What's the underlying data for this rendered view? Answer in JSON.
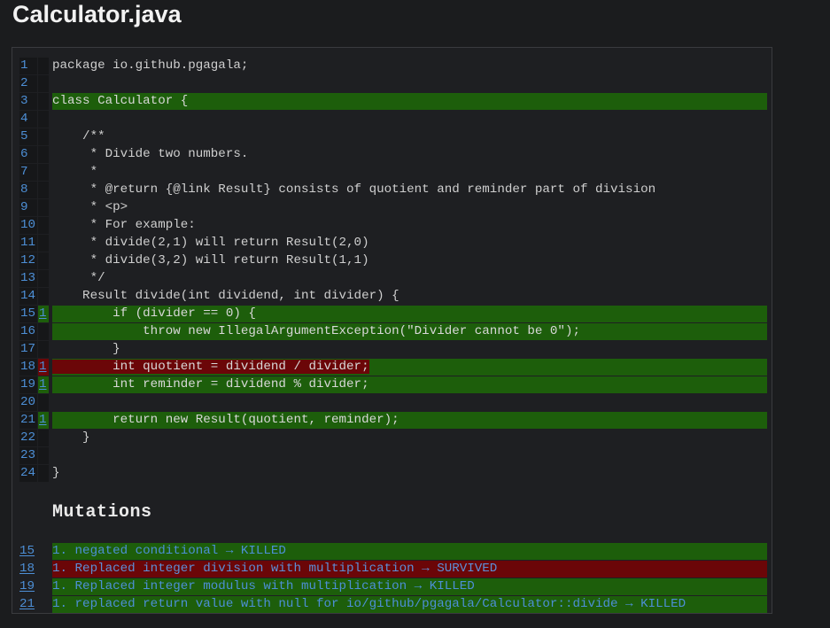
{
  "title": "Calculator.java",
  "code_lines": [
    {
      "num": "1",
      "count": "",
      "status": "none",
      "text": "package io.github.pgagala;"
    },
    {
      "num": "2",
      "count": "",
      "status": "none",
      "text": ""
    },
    {
      "num": "3",
      "count": "",
      "status": "covered",
      "text": "class Calculator {"
    },
    {
      "num": "4",
      "count": "",
      "status": "none",
      "text": ""
    },
    {
      "num": "5",
      "count": "",
      "status": "none",
      "text": "    /**"
    },
    {
      "num": "6",
      "count": "",
      "status": "none",
      "text": "     * Divide two numbers."
    },
    {
      "num": "7",
      "count": "",
      "status": "none",
      "text": "     *"
    },
    {
      "num": "8",
      "count": "",
      "status": "none",
      "text": "     * @return {@link Result} consists of quotient and reminder part of division"
    },
    {
      "num": "9",
      "count": "",
      "status": "none",
      "text": "     * <p>"
    },
    {
      "num": "10",
      "count": "",
      "status": "none",
      "text": "     * For example:"
    },
    {
      "num": "11",
      "count": "",
      "status": "none",
      "text": "     * divide(2,1) will return Result(2,0)"
    },
    {
      "num": "12",
      "count": "",
      "status": "none",
      "text": "     * divide(3,2) will return Result(1,1)"
    },
    {
      "num": "13",
      "count": "",
      "status": "none",
      "text": "     */"
    },
    {
      "num": "14",
      "count": "",
      "status": "none",
      "text": "    Result divide(int dividend, int divider) {"
    },
    {
      "num": "15",
      "count": "1",
      "status": "killed",
      "text": "        if (divider == 0) {"
    },
    {
      "num": "16",
      "count": "",
      "status": "covered",
      "text": "            throw new IllegalArgumentException(\"Divider cannot be 0\");"
    },
    {
      "num": "17",
      "count": "",
      "status": "none",
      "text": "        }"
    },
    {
      "num": "18",
      "count": "1",
      "status": "survived",
      "text": "        int quotient = dividend / divider;"
    },
    {
      "num": "19",
      "count": "1",
      "status": "killed",
      "text": "        int reminder = dividend % divider;"
    },
    {
      "num": "20",
      "count": "",
      "status": "none",
      "text": ""
    },
    {
      "num": "21",
      "count": "1",
      "status": "killed",
      "text": "        return new Result(quotient, reminder);"
    },
    {
      "num": "22",
      "count": "",
      "status": "none",
      "text": "    }"
    },
    {
      "num": "23",
      "count": "",
      "status": "none",
      "text": ""
    },
    {
      "num": "24",
      "count": "",
      "status": "none",
      "text": "}"
    }
  ],
  "mutations_heading": "Mutations",
  "mutations": [
    {
      "line": "15",
      "status": "killed",
      "text": "1. negated conditional → KILLED"
    },
    {
      "line": "18",
      "status": "survived",
      "text": "1. Replaced integer division with multiplication → SURVIVED"
    },
    {
      "line": "19",
      "status": "killed",
      "text": "1. Replaced integer modulus with multiplication → KILLED"
    },
    {
      "line": "21",
      "status": "killed",
      "text": "1. replaced return value with null for io/github/pgagala/Calculator::divide → KILLED"
    }
  ],
  "colors": {
    "covered": "#1d5e0b",
    "survived": "#6b0608",
    "link": "#4d8fd6",
    "background": "#1b1c1e"
  }
}
